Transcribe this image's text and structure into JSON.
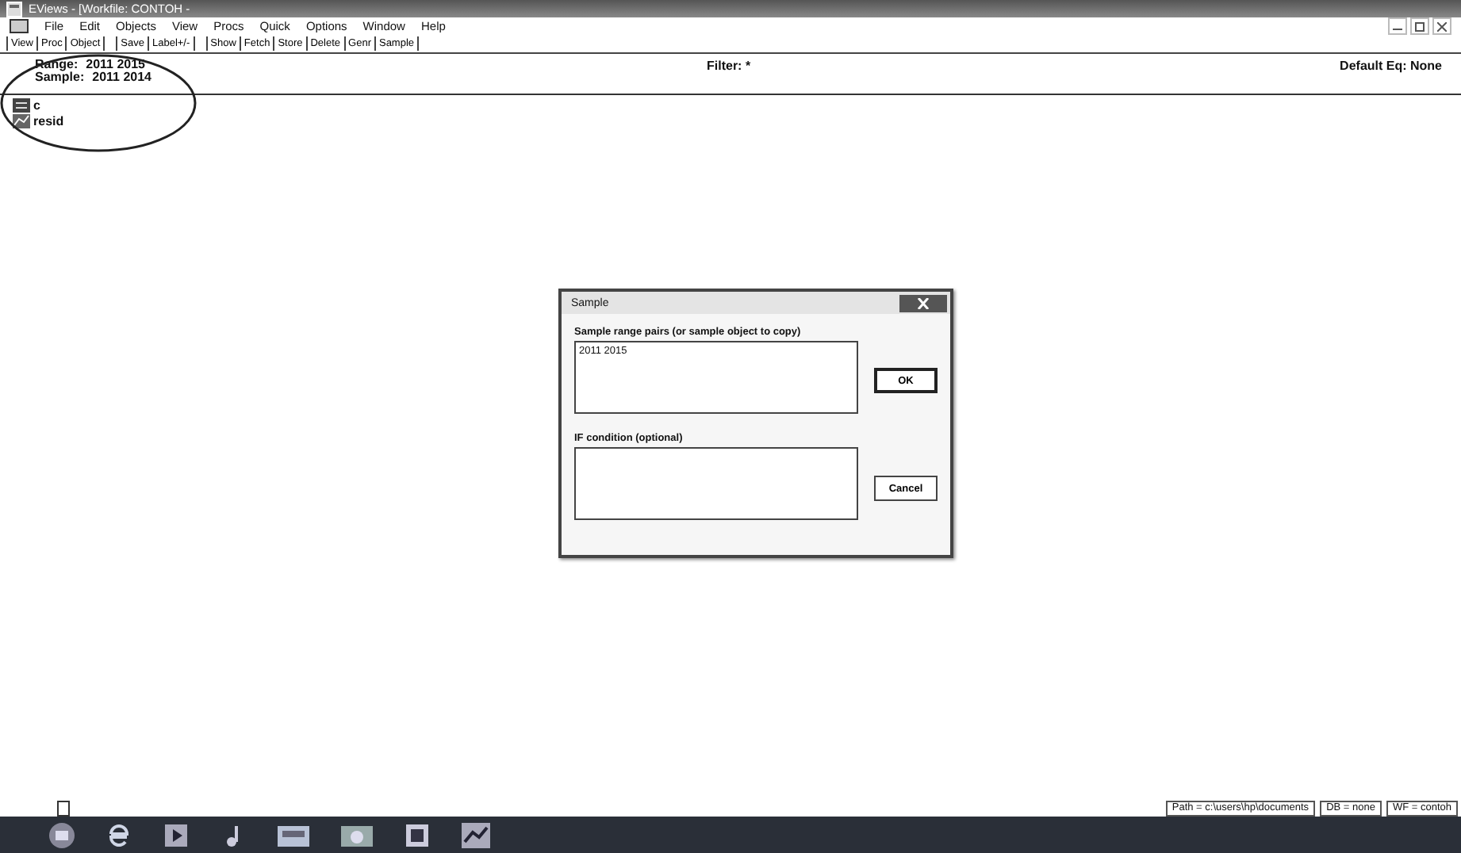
{
  "window": {
    "title": "EViews - [Workfile: CONTOH -"
  },
  "menu": [
    "File",
    "Edit",
    "Objects",
    "View",
    "Procs",
    "Quick",
    "Options",
    "Window",
    "Help"
  ],
  "toolbar": [
    [
      "View",
      "Proc",
      "Object"
    ],
    [
      "Save",
      "Label+/-"
    ],
    [
      "Show",
      "Fetch",
      "Store",
      "Delete",
      "Genr",
      "Sample"
    ]
  ],
  "info": {
    "range_label": "Range:",
    "range": "2011 2015",
    "sample_label": "Sample:",
    "sample": "2011 2014",
    "filter": "Filter: *",
    "default_eq": "Default Eq: None"
  },
  "objects": [
    {
      "name": "c",
      "kind": "coef"
    },
    {
      "name": "resid",
      "kind": "series"
    }
  ],
  "dialog": {
    "title": "Sample",
    "range_label": "Sample range pairs (or sample object to copy)",
    "range_value": "2011 2015",
    "if_label": "IF condition (optional)",
    "buttons": [
      "OK",
      "Cancel"
    ]
  },
  "status_bar": [
    "Path = c:\\users\\hp\\documents",
    "DB = none",
    "WF = contoh"
  ]
}
